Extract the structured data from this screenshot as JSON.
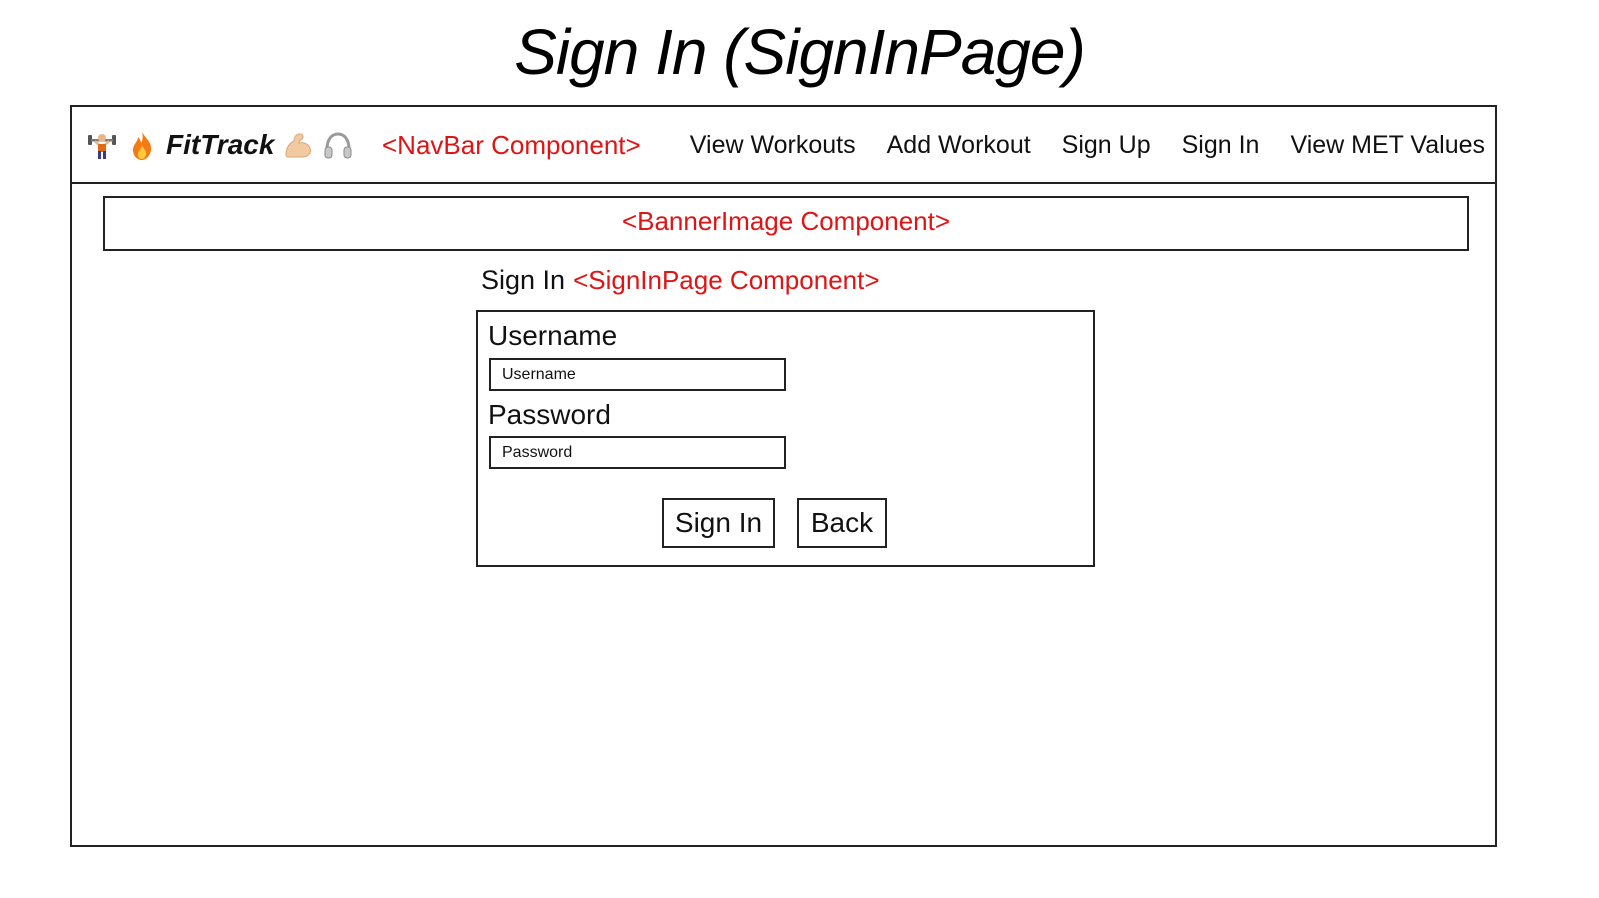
{
  "page_title": "Sign In (SignInPage)",
  "navbar": {
    "brand_name": "FitTrack",
    "brand_icons": [
      "weightlifter-icon",
      "fire-icon",
      "flexed-biceps-icon",
      "headphones-icon"
    ],
    "component_annotation": "<NavBar Component>",
    "links": [
      {
        "label": "View Workouts"
      },
      {
        "label": "Add Workout"
      },
      {
        "label": "Sign Up"
      },
      {
        "label": "Sign In"
      },
      {
        "label": "View MET Values"
      }
    ]
  },
  "banner": {
    "component_annotation": "<BannerImage Component>"
  },
  "signin": {
    "heading": "Sign In",
    "component_annotation": "<SignInPage Component>",
    "username_label": "Username",
    "username_placeholder": "Username",
    "password_label": "Password",
    "password_placeholder": "Password",
    "submit_label": "Sign In",
    "back_label": "Back"
  },
  "colors": {
    "annotation": "#e01414",
    "border": "#222222",
    "text": "#111111"
  }
}
